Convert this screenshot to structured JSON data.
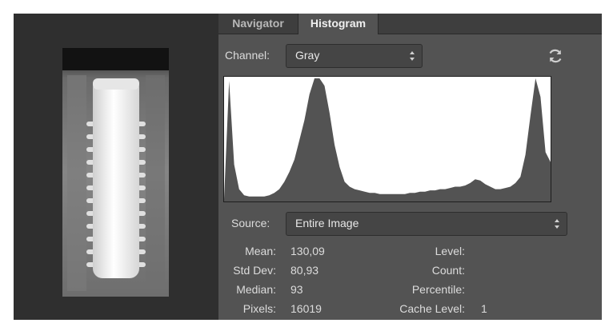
{
  "tabs": [
    {
      "label": "Navigator",
      "active": false
    },
    {
      "label": "Histogram",
      "active": true
    }
  ],
  "channel": {
    "label": "Channel:",
    "value": "Gray"
  },
  "source": {
    "label": "Source:",
    "value": "Entire Image"
  },
  "refresh_icon": "refresh-icon",
  "stats": {
    "mean": {
      "label": "Mean:",
      "value": "130,09"
    },
    "std_dev": {
      "label": "Std Dev:",
      "value": "80,93"
    },
    "median": {
      "label": "Median:",
      "value": "93"
    },
    "pixels": {
      "label": "Pixels:",
      "value": "16019"
    },
    "level": {
      "label": "Level:",
      "value": ""
    },
    "count": {
      "label": "Count:",
      "value": ""
    },
    "percentile": {
      "label": "Percentile:",
      "value": ""
    },
    "cache_level": {
      "label": "Cache Level:",
      "value": "1"
    }
  },
  "colors": {
    "panel_bg": "#535353",
    "tab_bar": "#3e3e3e",
    "histogram_fill": "#535353",
    "histogram_bg": "#ffffff"
  },
  "histogram_profile": [
    0.02,
    0.98,
    0.3,
    0.1,
    0.05,
    0.04,
    0.04,
    0.04,
    0.04,
    0.05,
    0.07,
    0.1,
    0.16,
    0.24,
    0.34,
    0.5,
    0.66,
    0.87,
    1.0,
    1.0,
    0.94,
    0.72,
    0.46,
    0.28,
    0.16,
    0.12,
    0.1,
    0.09,
    0.08,
    0.07,
    0.07,
    0.06,
    0.06,
    0.06,
    0.06,
    0.06,
    0.06,
    0.07,
    0.07,
    0.08,
    0.08,
    0.09,
    0.09,
    0.1,
    0.1,
    0.11,
    0.12,
    0.12,
    0.13,
    0.15,
    0.18,
    0.17,
    0.14,
    0.12,
    0.1,
    0.1,
    0.11,
    0.12,
    0.15,
    0.2,
    0.38,
    0.7,
    1.0,
    0.85,
    0.4,
    0.32
  ]
}
